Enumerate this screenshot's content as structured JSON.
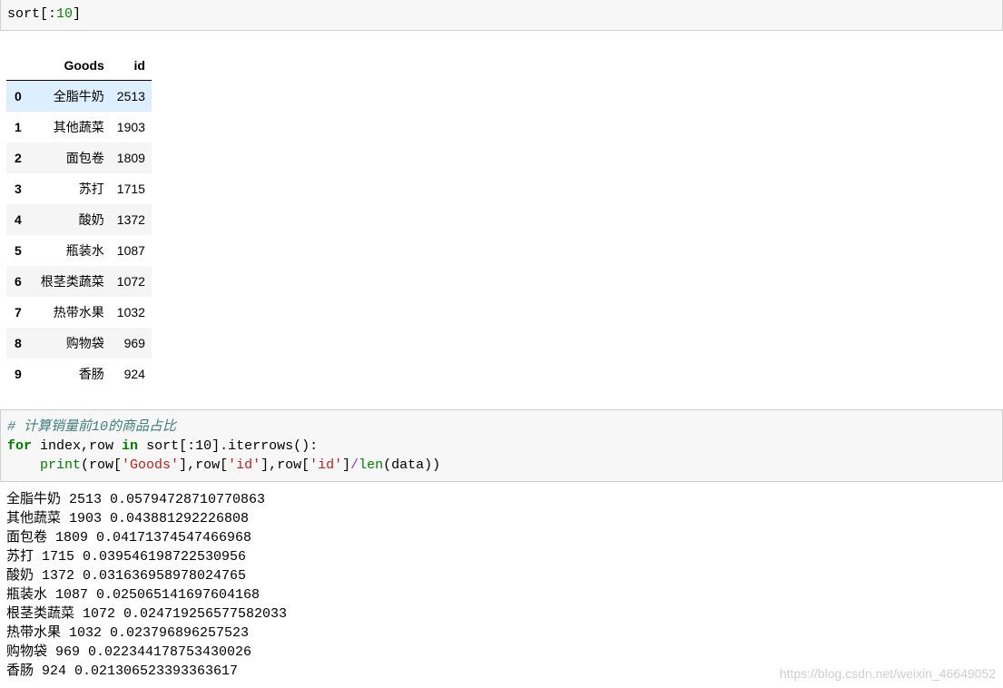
{
  "cell1": {
    "code_ident": "sort",
    "code_open": "[:",
    "code_num": "10",
    "code_close": "]"
  },
  "dataframe": {
    "columns": [
      "Goods",
      "id"
    ],
    "rows": [
      {
        "index": "0",
        "goods": "全脂牛奶",
        "id": "2513"
      },
      {
        "index": "1",
        "goods": "其他蔬菜",
        "id": "1903"
      },
      {
        "index": "2",
        "goods": "面包卷",
        "id": "1809"
      },
      {
        "index": "3",
        "goods": "苏打",
        "id": "1715"
      },
      {
        "index": "4",
        "goods": "酸奶",
        "id": "1372"
      },
      {
        "index": "5",
        "goods": "瓶装水",
        "id": "1087"
      },
      {
        "index": "6",
        "goods": "根茎类蔬菜",
        "id": "1072"
      },
      {
        "index": "7",
        "goods": "热带水果",
        "id": "1032"
      },
      {
        "index": "8",
        "goods": "购物袋",
        "id": "969"
      },
      {
        "index": "9",
        "goods": "香肠",
        "id": "924"
      }
    ]
  },
  "cell2": {
    "comment": "# 计算销量前10的商品占比",
    "line2": {
      "kw_for": "for",
      "mid1": " index,row ",
      "kw_in": "in",
      "mid2": " sort[:10].iterrows():"
    },
    "line3": {
      "indent": "    ",
      "fn_print": "print",
      "p1": "(row[",
      "s1": "'Goods'",
      "p2": "],row[",
      "s2": "'id'",
      "p3": "],row[",
      "s3": "'id'",
      "p4": "]",
      "op": "/",
      "fn_len": "len",
      "p5": "(data))"
    }
  },
  "output2": [
    "全脂牛奶 2513 0.05794728710770863",
    "其他蔬菜 1903 0.043881292226808",
    "面包卷 1809 0.04171374547466968",
    "苏打 1715 0.039546198722530956",
    "酸奶 1372 0.031636958978024765",
    "瓶装水 1087 0.025065141697604168",
    "根茎类蔬菜 1072 0.024719256577582033",
    "热带水果 1032 0.023796896257523",
    "购物袋 969 0.022344178753430026",
    "香肠 924 0.021306523393363617"
  ],
  "watermark": "https://blog.csdn.net/weixin_46649052"
}
